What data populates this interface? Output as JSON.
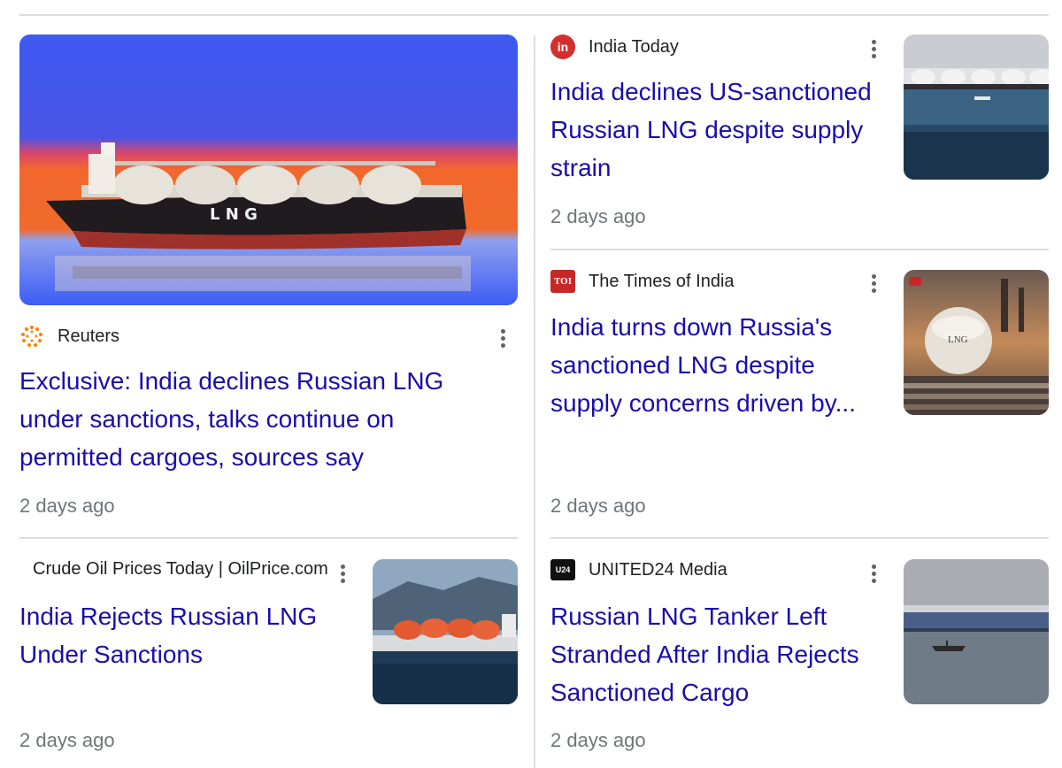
{
  "articles": [
    {
      "source": "Reuters",
      "headline": "Exclusive: India declines Russian LNG under sanctions, talks continue on permitted cargoes, sources say",
      "time": "2 days ago",
      "image_icon": "lng-tanker-image"
    },
    {
      "source": "India Today",
      "favicon_text": "in",
      "headline": "India declines US-sanctioned Russian LNG despite supply strain",
      "time": "2 days ago",
      "image_icon": "lng-terminal-image"
    },
    {
      "source": "The Times of India",
      "favicon_text": "TOI",
      "headline": "India turns down Russia's sanctioned LNG despite supply concerns driven by...",
      "time": "2 days ago",
      "image_icon": "lng-plant-image"
    },
    {
      "source": "Crude Oil Prices Today | OilPrice.com",
      "headline": "India Rejects Russian LNG Under Sanctions",
      "time": "2 days ago",
      "image_icon": "lng-carrier-image"
    },
    {
      "source": "UNITED24 Media",
      "favicon_text": "U24",
      "headline": "Russian LNG Tanker Left Stranded After India Rejects Sanctioned Cargo",
      "time": "2 days ago",
      "image_icon": "stranded-tanker-image"
    }
  ],
  "image_text": {
    "ship_label": "L N G",
    "tank_label": "LNG"
  },
  "colors": {
    "headline": "#1a0dab",
    "meta": "#70757a",
    "reuters": "#ff8000",
    "india_today": "#d32f2f",
    "toi": "#c62828"
  }
}
